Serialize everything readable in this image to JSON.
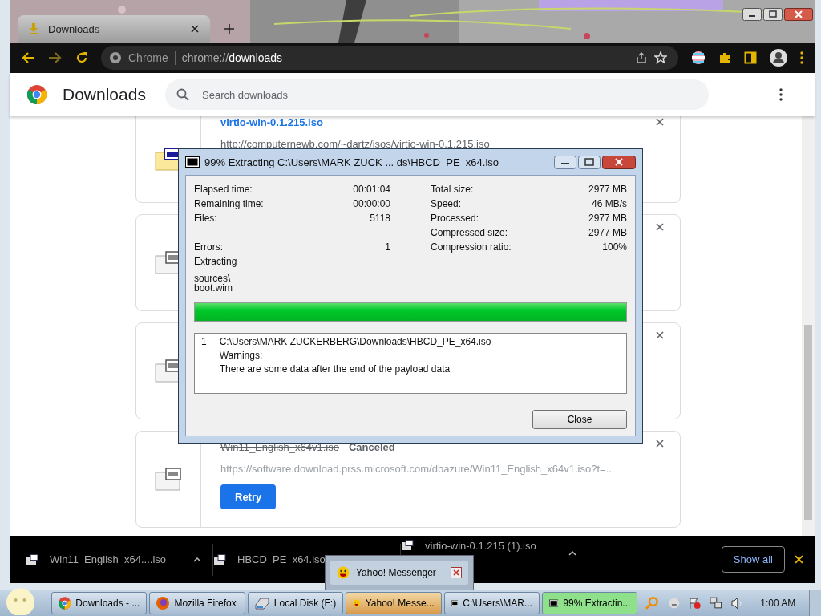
{
  "browser": {
    "tabs": [
      {
        "title": "Downloads",
        "selected": true
      }
    ],
    "omnibox": {
      "chip": "Chrome",
      "url": "chrome://**downloads**"
    }
  },
  "header": {
    "title": "Downloads",
    "search": {
      "placeholder": "Search downloads"
    }
  },
  "downloads": [
    {
      "kind": "mounted",
      "name": "virtio-win-0.1.215.iso",
      "url": "http://computernewb.com/~dartz/isos/virtio-win-0.1.215.iso",
      "canceled": false
    },
    {
      "kind": "plain"
    },
    {
      "kind": "plain"
    },
    {
      "kind": "plain",
      "name": "Win11_English_x64v1.iso",
      "status": "Canceled",
      "url": "https://software.download.prss.microsoft.com/dbazure/Win11_English_x64v1.iso?t=...",
      "canceled": true,
      "action": "Retry"
    }
  ],
  "dialog": {
    "title": "99% Extracting C:\\Users\\MARK ZUCK ... ds\\HBCD_PE_x64.iso",
    "left": [
      {
        "label": "Elapsed time:",
        "value": "00:01:04"
      },
      {
        "label": "Remaining time:",
        "value": "00:00:00"
      },
      {
        "label": "Files:",
        "value": "5118"
      },
      {
        "label": "Errors:",
        "value": "1"
      }
    ],
    "right": [
      {
        "label": "Total size:",
        "value": "2977 MB"
      },
      {
        "label": "Speed:",
        "value": "46 MB/s"
      },
      {
        "label": "Processed:",
        "value": "2977 MB"
      },
      {
        "label": "Compressed size:",
        "value": "2977 MB"
      },
      {
        "label": "Compression ratio:",
        "value": "100%"
      }
    ],
    "action": "Extracting",
    "current_file": [
      "sources\\",
      "boot.wim"
    ],
    "progress": {
      "level": 1
    },
    "log": [
      {
        "number": "1",
        "lines": [
          "C:\\Users\\MARK ZUCKERBERG\\Downloads\\HBCD_PE_x64.iso",
          "Warnings:",
          "There are some data after the end of the payload data"
        ]
      }
    ],
    "close_button": "Close"
  },
  "shelf": {
    "items": [
      {
        "name": "Win11_English_x64....iso"
      },
      {
        "name": "HBCD_PE_x64.iso"
      },
      {
        "name": "virtio-win-0.1.215 (1).iso"
      }
    ],
    "show_all": "Show all"
  },
  "popup": {
    "title": "Yahoo! Messenger"
  },
  "taskbar": {
    "items": [
      {
        "kind": "chrome",
        "label": "Downloads - ...",
        "selected": false
      },
      {
        "kind": "firefox",
        "label": "Mozilla Firefox",
        "selected": false
      },
      {
        "kind": "drive",
        "label": "Local Disk (F:)",
        "selected": false
      },
      {
        "kind": "smiley",
        "label": "Yahoo! Messe...",
        "selected": true
      },
      {
        "kind": "archive",
        "label": "C:\\Users\\MAR...",
        "selected": false
      },
      {
        "kind": "archive",
        "label": "99% Extractin...",
        "selected": false,
        "level": 1
      }
    ],
    "clock": "1:00 AM"
  }
}
